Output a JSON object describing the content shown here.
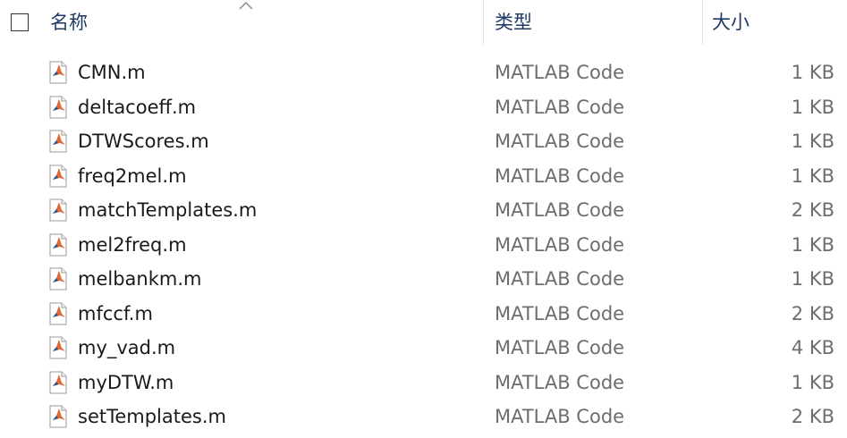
{
  "header": {
    "name_label": "名称",
    "type_label": "类型",
    "size_label": "大小",
    "sort": "ascending"
  },
  "files": [
    {
      "name": "CMN.m",
      "type": "MATLAB Code",
      "size": "1 KB",
      "icon": "matlab-file-icon"
    },
    {
      "name": "deltacoeff.m",
      "type": "MATLAB Code",
      "size": "1 KB",
      "icon": "matlab-file-icon"
    },
    {
      "name": "DTWScores.m",
      "type": "MATLAB Code",
      "size": "1 KB",
      "icon": "matlab-file-icon"
    },
    {
      "name": "freq2mel.m",
      "type": "MATLAB Code",
      "size": "1 KB",
      "icon": "matlab-file-icon"
    },
    {
      "name": "matchTemplates.m",
      "type": "MATLAB Code",
      "size": "2 KB",
      "icon": "matlab-file-icon"
    },
    {
      "name": "mel2freq.m",
      "type": "MATLAB Code",
      "size": "1 KB",
      "icon": "matlab-file-icon"
    },
    {
      "name": "melbankm.m",
      "type": "MATLAB Code",
      "size": "1 KB",
      "icon": "matlab-file-icon"
    },
    {
      "name": "mfccf.m",
      "type": "MATLAB Code",
      "size": "2 KB",
      "icon": "matlab-file-icon"
    },
    {
      "name": "my_vad.m",
      "type": "MATLAB Code",
      "size": "4 KB",
      "icon": "matlab-file-icon"
    },
    {
      "name": "myDTW.m",
      "type": "MATLAB Code",
      "size": "1 KB",
      "icon": "matlab-file-icon"
    },
    {
      "name": "setTemplates.m",
      "type": "MATLAB Code",
      "size": "2 KB",
      "icon": "matlab-file-icon"
    }
  ],
  "colors": {
    "header_text": "#1f3a66",
    "name_text": "#1a1a1a",
    "meta_text": "#6d6d6d",
    "matlab_orange": "#e16737",
    "matlab_blue": "#1c5c9e"
  }
}
